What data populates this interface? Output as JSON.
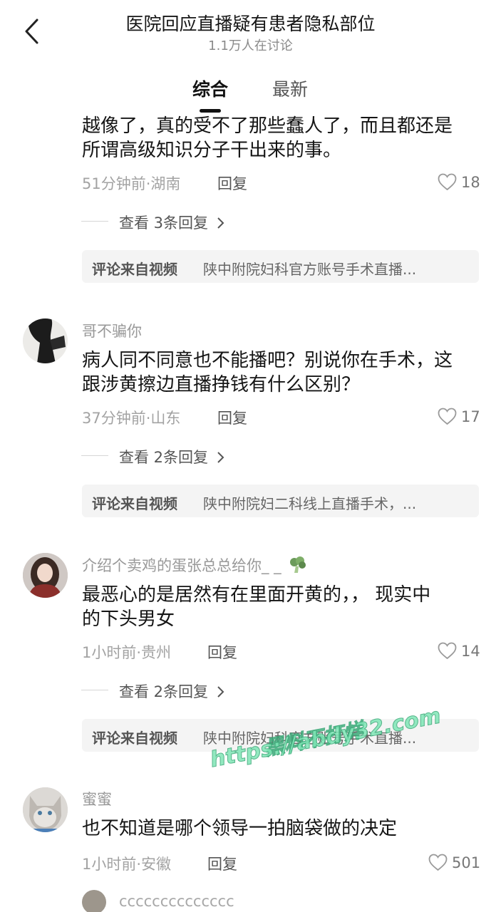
{
  "header": {
    "title": "医院回应直播疑有患者隐私部位",
    "subtitle": "1.1万人在讨论",
    "tabs": [
      {
        "label": "综合",
        "active": true
      },
      {
        "label": "最新",
        "active": false
      }
    ]
  },
  "comments": [
    {
      "text_line1": "越像了，真的受不了那些蠢人了，而且都还是",
      "text_line2": "所谓高级知识分子干出来的事。",
      "meta": "51分钟前·湖南",
      "reply_label": "回复",
      "likes": "18",
      "view_replies": "查看 3条回复",
      "from_label": "评论来自视频",
      "from_text": "陕中附院妇科官方账号手术直播..."
    },
    {
      "username": "哥不骗你",
      "text_line1": "病人同不同意也不能播吧？别说你在手术，这",
      "text_line2": "跟涉黄擦边直播挣钱有什么区别？",
      "meta": "37分钟前·山东",
      "reply_label": "回复",
      "likes": "17",
      "view_replies": "查看 2条回复",
      "from_label": "评论来自视频",
      "from_text": "陕中附院妇二科线上直播手术，..."
    },
    {
      "username": "介绍个卖鸡的蛋张总总给你_ _",
      "text_line1": "最恶心的是居然有在里面开黄的，，  现实中",
      "text_line2": "的下头男女",
      "meta": "1小时前·贵州",
      "reply_label": "回复",
      "likes": "14",
      "view_replies": "查看 2条回复",
      "from_label": "评论来自视频",
      "from_text": "陕中附院妇科官方账号手术直播..."
    },
    {
      "username": "蜜蜜",
      "text_line1": "也不知道是哪个领导一拍脑袋做的决定",
      "meta": "1小时前·安徽",
      "reply_label": "回复",
      "likes": "501"
    },
    {
      "username": "cccccccccccccc"
    }
  ],
  "watermark": {
    "line1": "黑料不打烊",
    "line2": "https://abdy32.com"
  }
}
